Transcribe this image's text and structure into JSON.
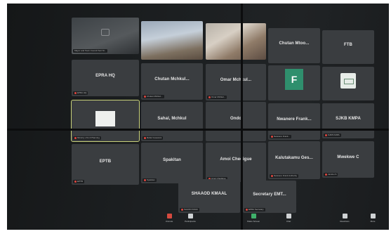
{
  "tiles": {
    "t1": {
      "label": "Mayor and Town Council Sort M...",
      "name": ""
    },
    "t2": {
      "label": "",
      "name": ""
    },
    "t3": {
      "label": "",
      "name": ""
    },
    "t4": {
      "label": "",
      "name": "Chutan Mtoo..."
    },
    "t5": {
      "label": "",
      "name": "FTB"
    },
    "t6": {
      "label": "EPRA HQ",
      "name": "EPRA HQ"
    },
    "t7": {
      "label": "Chutan Mchkul...",
      "name": "Chutan Mchkul..."
    },
    "t8": {
      "label": "Omar Mchkul...",
      "name": "Omar Mchkul..."
    },
    "t9": {
      "label": "",
      "name": "F"
    },
    "t10": {
      "label": "",
      "name": ""
    },
    "t11": {
      "label": "Ministry of E & Planning",
      "name": ""
    },
    "t12": {
      "label": "Rahul Goswami",
      "name": "Sahal, Mchkul"
    },
    "t13": {
      "label": "",
      "name": "Ondo"
    },
    "t14": {
      "label": "Nwanere Frank...",
      "name": "Nwanere Frank..."
    },
    "t15": {
      "label": "SJKB KMPA",
      "name": "SJKB KMPA"
    },
    "t16": {
      "label": "EPTB",
      "name": "EPTB"
    },
    "t17": {
      "label": "Spakitan",
      "name": "Spakitan"
    },
    "t18": {
      "label": "Amoi Chedigue",
      "name": "Amoi Chedigue"
    },
    "t19": {
      "label": "Nwanere Frank Authority",
      "name": "Kalutakamu Ges..."
    },
    "t20": {
      "label": "Jamiku S",
      "name": "Mwekwe C"
    },
    "t21": {
      "label": "SAAOD KMAK",
      "name": "SHAAOD KMAAL"
    },
    "t22": {
      "label": "EPRA Secretary",
      "name": "Secretary EMT..."
    }
  },
  "toolbar": [
    {
      "icon": "mic-icon",
      "label": "Unmute"
    },
    {
      "icon": "participants-icon",
      "label": "Participants"
    },
    {
      "icon": "share-screen-icon",
      "label": "Share Screen"
    },
    {
      "icon": "chat-icon",
      "label": "Chat"
    },
    {
      "icon": "reactions-icon",
      "label": "Reactions"
    },
    {
      "icon": "more-icon",
      "label": "More"
    }
  ]
}
